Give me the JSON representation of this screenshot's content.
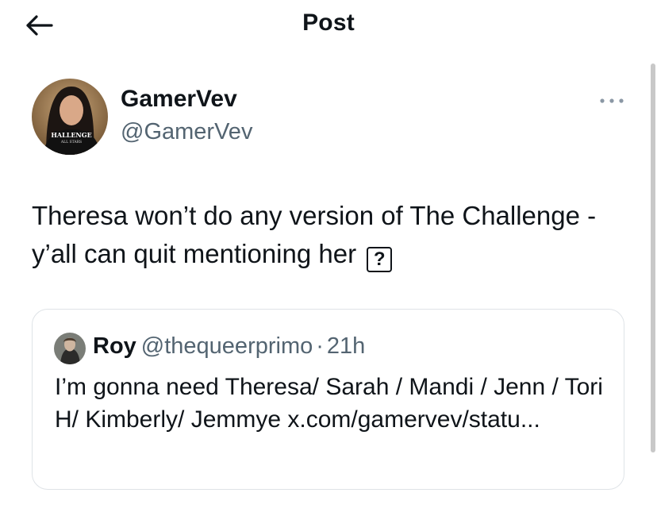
{
  "header": {
    "title": "Post",
    "back_icon": "arrow-left-icon"
  },
  "post": {
    "author": {
      "display_name": "GamerVev",
      "handle": "@GamerVev",
      "avatar_shirt_text": "HALLENGE",
      "avatar_shirt_subtext": "ALL STARS"
    },
    "text": "Theresa won’t do any version of The Challenge - y’all can quit mentioning her",
    "trailing_glyph": "?",
    "more_icon": "more-horizontal-icon"
  },
  "quote": {
    "author_name": "Roy",
    "handle": "@thequeerprimo",
    "separator": "·",
    "time": "21h",
    "text": "I’m gonna need Theresa/ Sarah / Mandi / Jenn / Tori H/ Kimberly/ Jemmye x.com/gamervev/statu..."
  },
  "colors": {
    "text_primary": "#0f1419",
    "text_secondary": "#536471",
    "border": "#dfe3e7",
    "background": "#ffffff"
  }
}
